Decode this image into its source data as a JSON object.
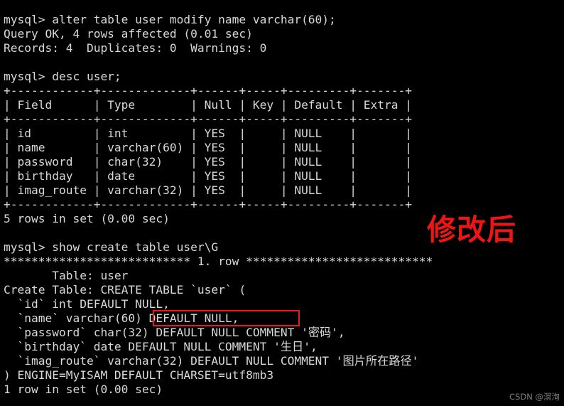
{
  "terminal": {
    "lines": [
      "mysql> alter table user modify name varchar(60);",
      "Query OK, 4 rows affected (0.01 sec)",
      "Records: 4  Duplicates: 0  Warnings: 0",
      "",
      "mysql> desc user;",
      "+------------+-------------+------+-----+---------+-------+",
      "| Field      | Type        | Null | Key | Default | Extra |",
      "+------------+-------------+------+-----+---------+-------+",
      "| id         | int         | YES  |     | NULL    |       |",
      "| name       | varchar(60) | YES  |     | NULL    |       |",
      "| password   | char(32)    | YES  |     | NULL    |       |",
      "| birthday   | date        | YES  |     | NULL    |       |",
      "| imag_route | varchar(32) | YES  |     | NULL    |       |",
      "+------------+-------------+------+-----+---------+-------+",
      "5 rows in set (0.00 sec)",
      "",
      "mysql> show create table user\\G",
      "*************************** 1. row ***************************",
      "       Table: user",
      "Create Table: CREATE TABLE `user` (",
      "  `id` int DEFAULT NULL,",
      "  `name` varchar(60) DEFAULT NULL,",
      "  `password` char(32) DEFAULT NULL COMMENT '密码',",
      "  `birthday` date DEFAULT NULL COMMENT '生日',",
      "  `imag_route` varchar(32) DEFAULT NULL COMMENT '图片所在路径'",
      ") ENGINE=MyISAM DEFAULT CHARSET=utf8mb3",
      "1 row in set (0.00 sec)"
    ],
    "prompt_commands": [
      "alter table user modify name varchar(60);",
      "desc user;",
      "show create table user\\G"
    ],
    "desc_table": {
      "columns": [
        "Field",
        "Type",
        "Null",
        "Key",
        "Default",
        "Extra"
      ],
      "rows": [
        [
          "id",
          "int",
          "YES",
          "",
          "NULL",
          ""
        ],
        [
          "name",
          "varchar(60)",
          "YES",
          "",
          "NULL",
          ""
        ],
        [
          "password",
          "char(32)",
          "YES",
          "",
          "NULL",
          ""
        ],
        [
          "birthday",
          "date",
          "YES",
          "",
          "NULL",
          ""
        ],
        [
          "imag_route",
          "varchar(32)",
          "YES",
          "",
          "NULL",
          ""
        ]
      ],
      "row_count_text": "5 rows in set (0.00 sec)"
    },
    "create_table": {
      "table_name": "user",
      "engine": "MyISAM",
      "charset": "utf8mb3",
      "row_count_text": "1 row in set (0.00 sec)",
      "definitions": [
        {
          "column": "id",
          "type": "int",
          "default": "DEFAULT NULL",
          "comment": ""
        },
        {
          "column": "name",
          "type": "varchar(60)",
          "default": "DEFAULT NULL",
          "comment": ""
        },
        {
          "column": "password",
          "type": "char(32)",
          "default": "DEFAULT NULL",
          "comment": "密码"
        },
        {
          "column": "birthday",
          "type": "date",
          "default": "DEFAULT NULL",
          "comment": "生日"
        },
        {
          "column": "imag_route",
          "type": "varchar(32)",
          "default": "DEFAULT NULL",
          "comment": "图片所在路径"
        }
      ]
    }
  },
  "annotations": {
    "label": "修改后",
    "label_color": "#f01414",
    "highlight_box_color": "#e02020",
    "highlighted_text": "DEFAULT NULL,"
  },
  "watermark": {
    "text": "CSDN @溟洵",
    "color": "#8a8a8a"
  },
  "theme": {
    "background": "#000000",
    "foreground": "#d8d8d8"
  }
}
